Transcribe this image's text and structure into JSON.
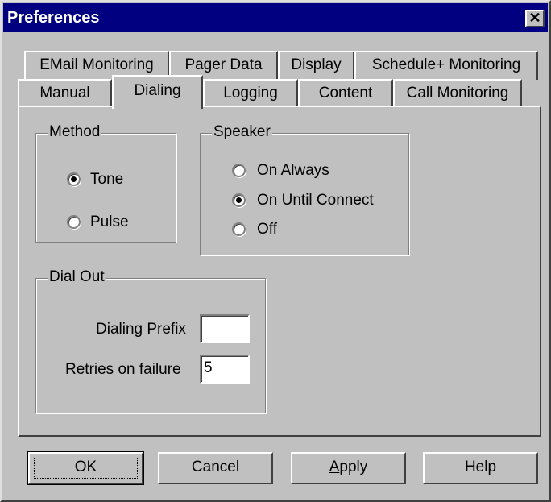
{
  "window": {
    "title": "Preferences",
    "close_glyph": "✕"
  },
  "tabs": {
    "row1": [
      {
        "label": "EMail Monitoring"
      },
      {
        "label": "Pager Data"
      },
      {
        "label": "Display"
      },
      {
        "label": "Schedule+ Monitoring"
      }
    ],
    "row2": [
      {
        "label": "Manual"
      },
      {
        "label": "Dialing",
        "selected": true
      },
      {
        "label": "Logging"
      },
      {
        "label": "Content"
      },
      {
        "label": "Call Monitoring"
      }
    ]
  },
  "method": {
    "label": "Method",
    "options": [
      {
        "label": "Tone",
        "checked": true
      },
      {
        "label": "Pulse",
        "checked": false
      }
    ]
  },
  "speaker": {
    "label": "Speaker",
    "options": [
      {
        "label": "On Always",
        "checked": false
      },
      {
        "label": "On Until Connect",
        "checked": true
      },
      {
        "label": "Off",
        "checked": false
      }
    ]
  },
  "dial_out": {
    "label": "Dial Out",
    "prefix_label": "Dialing Prefix",
    "prefix_value": "",
    "retries_label": "Retries on failure",
    "retries_value": "5"
  },
  "buttons": {
    "ok": "OK",
    "cancel": "Cancel",
    "apply_first": "A",
    "apply_rest": "pply",
    "help": "Help"
  }
}
